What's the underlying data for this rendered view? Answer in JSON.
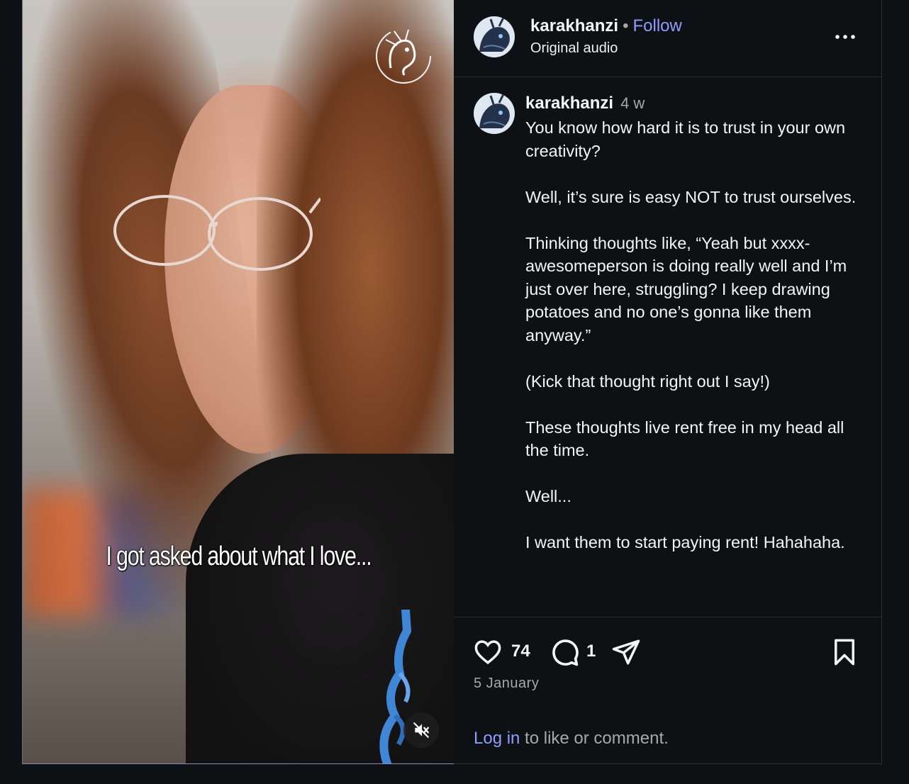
{
  "video": {
    "caption_overlay": "I got asked about what I love...",
    "mute_icon": "speaker-muted-icon",
    "watermark_icon": "dragon-logo-icon"
  },
  "header": {
    "username": "karakhanzi",
    "separator": "•",
    "follow_label": "Follow",
    "audio_label": "Original audio",
    "more_icon": "more-options-icon"
  },
  "caption": {
    "username": "karakhanzi",
    "time_ago": "4 w",
    "text": "You know how hard it is to trust in your own creativity?\n\nWell, it’s sure is easy NOT to trust ourselves.\n\nThinking thoughts like, “Yeah but xxxx-awesomeperson is doing really well and I’m just over here, struggling? I keep drawing potatoes and no one’s gonna like them anyway.”\n\n(Kick that thought right out I say!)\n\nThese thoughts live rent free in my head all the time.\n\nWell...\n\nI want them to start paying rent! Hahahaha."
  },
  "actions": {
    "like_icon": "heart-icon",
    "like_count": "74",
    "comment_icon": "comment-icon",
    "comment_count": "1",
    "share_icon": "share-icon",
    "save_icon": "bookmark-icon"
  },
  "post_date": "5 January",
  "login_prompt": {
    "link": "Log in",
    "rest": " to like or comment."
  },
  "colors": {
    "background": "#0d1114",
    "accent": "#8e9dff",
    "secondary_text": "#a8a8a8"
  }
}
